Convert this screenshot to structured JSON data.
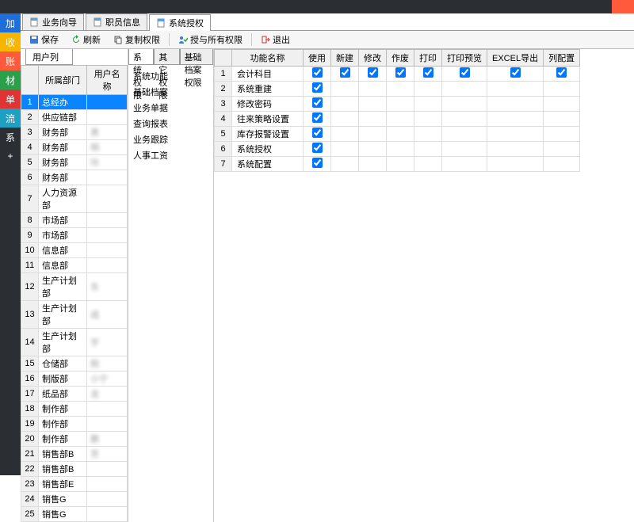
{
  "topbar": {
    "items": [
      "",
      "",
      "",
      "",
      ""
    ],
    "hot_label": ""
  },
  "leftnav": {
    "items": [
      {
        "label": "加",
        "cls": "c-add"
      },
      {
        "label": "收",
        "cls": "c-rcv"
      },
      {
        "label": "账",
        "cls": "c-acc"
      },
      {
        "label": "材",
        "cls": "c-mat"
      },
      {
        "label": "单",
        "cls": "c-ord"
      },
      {
        "label": "流",
        "cls": "c-flw"
      },
      {
        "label": "系",
        "cls": "c-sys"
      },
      {
        "label": "+",
        "cls": "c-sys"
      }
    ]
  },
  "tabs": [
    {
      "label": "业务向导",
      "active": false
    },
    {
      "label": "职员信息",
      "active": false
    },
    {
      "label": "系统授权",
      "active": true
    }
  ],
  "toolbar": {
    "save": "保存",
    "refresh": "刷新",
    "copy_perm": "复制权限",
    "grant_all": "授与所有权限",
    "exit": "退出"
  },
  "userlist": {
    "tab_label": "用户列表",
    "headers": {
      "dept": "所属部门",
      "name": "用户名称"
    },
    "rows": [
      {
        "dept": "总经办",
        "name": "",
        "sel": true
      },
      {
        "dept": "供应链部",
        "name": ""
      },
      {
        "dept": "财务部",
        "name": "男"
      },
      {
        "dept": "财务部",
        "name": "明"
      },
      {
        "dept": "财务部",
        "name": "玲"
      },
      {
        "dept": "财务部",
        "name": ""
      },
      {
        "dept": "人力资源部",
        "name": ""
      },
      {
        "dept": "市场部",
        "name": ""
      },
      {
        "dept": "市场部",
        "name": ""
      },
      {
        "dept": "信息部",
        "name": ""
      },
      {
        "dept": "信息部",
        "name": ""
      },
      {
        "dept": "生产计划部",
        "name": "东"
      },
      {
        "dept": "生产计划部",
        "name": "成"
      },
      {
        "dept": "生产计划部",
        "name": "宇"
      },
      {
        "dept": "仓储部",
        "name": "刚"
      },
      {
        "dept": "制版部",
        "name": "小宁"
      },
      {
        "dept": "纸品部",
        "name": "龙"
      },
      {
        "dept": "制作部",
        "name": ""
      },
      {
        "dept": "制作部",
        "name": ""
      },
      {
        "dept": "制作部",
        "name": "鹏"
      },
      {
        "dept": "销售部B",
        "name": "芳"
      },
      {
        "dept": "销售部B",
        "name": ""
      },
      {
        "dept": "销售部E",
        "name": ""
      },
      {
        "dept": "销售G",
        "name": ""
      },
      {
        "dept": "销售G",
        "name": ""
      }
    ]
  },
  "cat": {
    "tabs": [
      {
        "label": "系统权限",
        "active": true
      },
      {
        "label": "其它权限",
        "active": false
      },
      {
        "label": "基础档案权限",
        "active": false
      }
    ],
    "items": [
      "系统功能",
      "基础档案",
      "业务单据",
      "查询报表",
      "业务跟踪",
      "人事工资"
    ]
  },
  "perm": {
    "headers": [
      "功能名称",
      "使用",
      "新建",
      "修改",
      "作废",
      "打印",
      "打印预览",
      "EXCEL导出",
      "列配置"
    ],
    "rows": [
      {
        "name": "会计科目",
        "checks": [
          true,
          true,
          true,
          true,
          true,
          true,
          true,
          true
        ]
      },
      {
        "name": "系统重建",
        "checks": [
          true,
          false,
          false,
          false,
          false,
          false,
          false,
          false
        ]
      },
      {
        "name": "修改密码",
        "checks": [
          true,
          false,
          false,
          false,
          false,
          false,
          false,
          false
        ]
      },
      {
        "name": "往来策略设置",
        "checks": [
          true,
          false,
          false,
          false,
          false,
          false,
          false,
          false
        ]
      },
      {
        "name": "库存报警设置",
        "checks": [
          true,
          false,
          false,
          false,
          false,
          false,
          false,
          false
        ]
      },
      {
        "name": "系统授权",
        "checks": [
          true,
          false,
          false,
          false,
          false,
          false,
          false,
          false
        ]
      },
      {
        "name": "系统配置",
        "checks": [
          true,
          false,
          false,
          false,
          false,
          false,
          false,
          false
        ]
      }
    ]
  }
}
